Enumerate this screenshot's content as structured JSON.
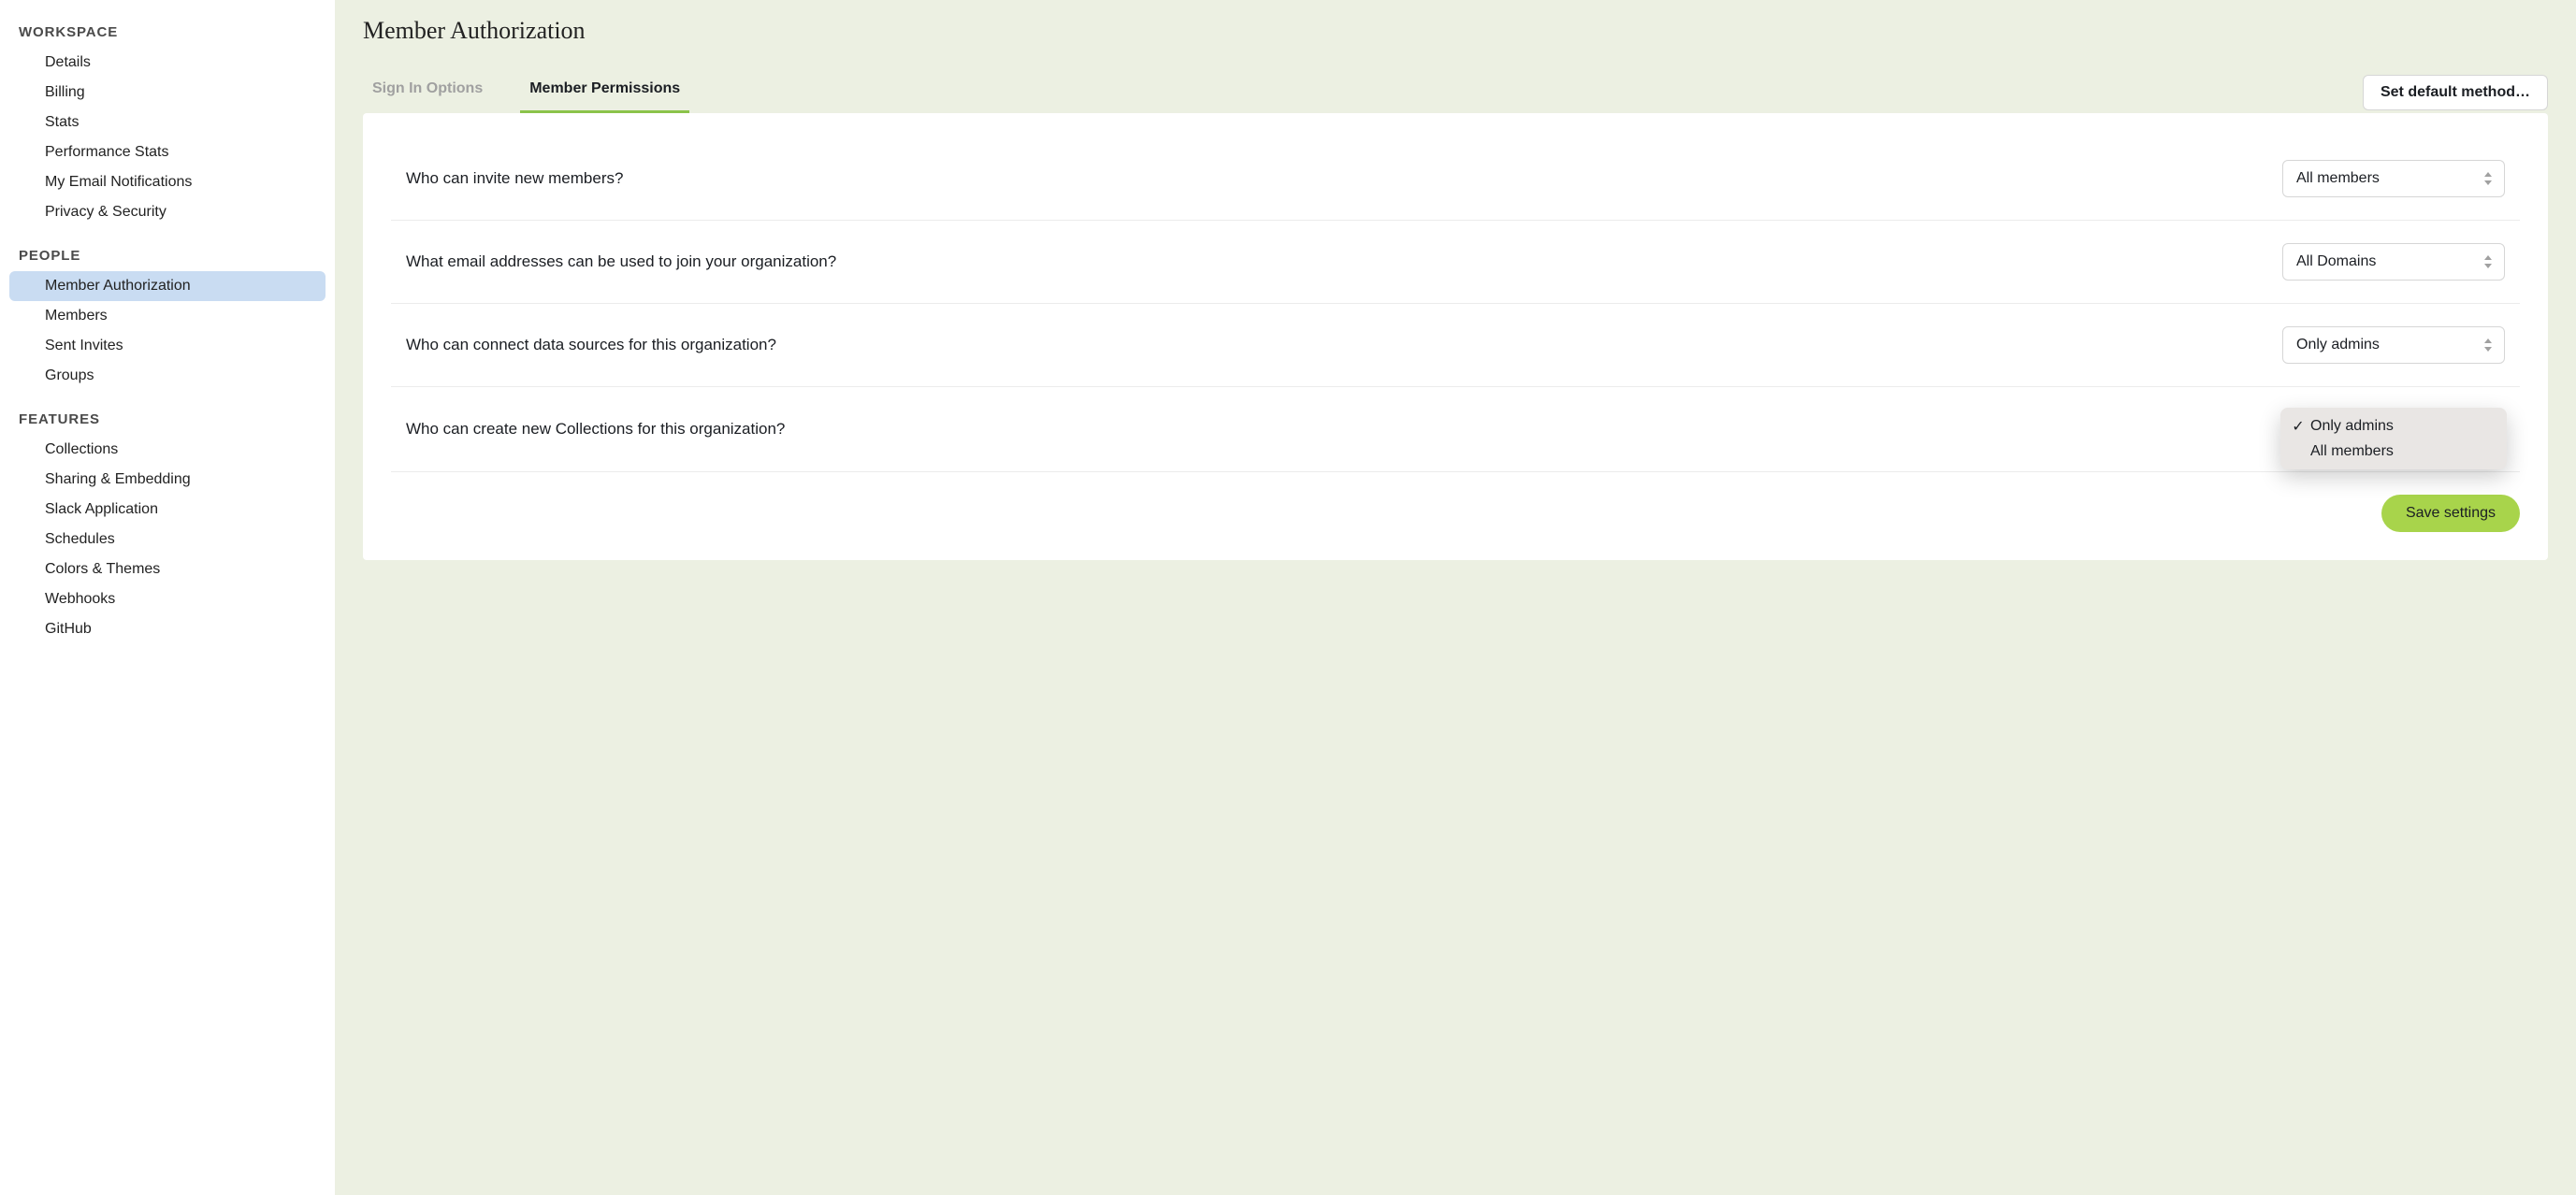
{
  "sidebar": {
    "sections": [
      {
        "header": "WORKSPACE",
        "items": [
          {
            "label": "Details",
            "active": false
          },
          {
            "label": "Billing",
            "active": false
          },
          {
            "label": "Stats",
            "active": false
          },
          {
            "label": "Performance Stats",
            "active": false
          },
          {
            "label": "My Email Notifications",
            "active": false
          },
          {
            "label": "Privacy & Security",
            "active": false
          }
        ]
      },
      {
        "header": "PEOPLE",
        "items": [
          {
            "label": "Member Authorization",
            "active": true
          },
          {
            "label": "Members",
            "active": false
          },
          {
            "label": "Sent Invites",
            "active": false
          },
          {
            "label": "Groups",
            "active": false
          }
        ]
      },
      {
        "header": "FEATURES",
        "items": [
          {
            "label": "Collections",
            "active": false
          },
          {
            "label": "Sharing & Embedding",
            "active": false
          },
          {
            "label": "Slack Application",
            "active": false
          },
          {
            "label": "Schedules",
            "active": false
          },
          {
            "label": "Colors & Themes",
            "active": false
          },
          {
            "label": "Webhooks",
            "active": false
          },
          {
            "label": "GitHub",
            "active": false
          }
        ]
      }
    ]
  },
  "page": {
    "title": "Member Authorization",
    "tabs": [
      {
        "label": "Sign In Options",
        "active": false
      },
      {
        "label": "Member Permissions",
        "active": true
      }
    ],
    "set_default_label": "Set default method…"
  },
  "settings": [
    {
      "label": "Who can invite new members?",
      "value": "All members",
      "open": false
    },
    {
      "label": "What email addresses can be used to join your organization?",
      "value": "All Domains",
      "open": false
    },
    {
      "label": "Who can connect data sources for this organization?",
      "value": "Only admins",
      "open": false
    },
    {
      "label": "Who can create new Collections for this organization?",
      "value": "",
      "open": true,
      "options": [
        {
          "label": "Only admins",
          "checked": true
        },
        {
          "label": "All members",
          "checked": false
        }
      ]
    }
  ],
  "save_label": "Save settings"
}
